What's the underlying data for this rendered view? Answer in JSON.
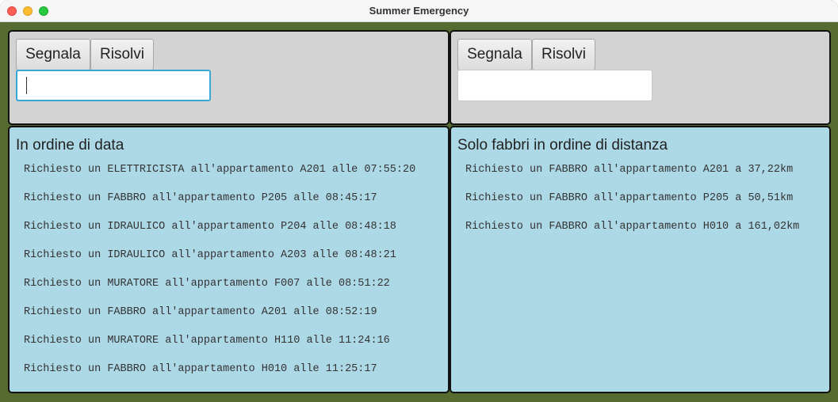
{
  "window": {
    "title": "Summer Emergency"
  },
  "left": {
    "segnala_label": "Segnala",
    "risolvi_label": "Risolvi",
    "input_value": "",
    "heading": "In ordine di data",
    "requests": [
      "Richiesto un ELETTRICISTA all'appartamento A201 alle 07:55:20",
      "Richiesto un FABBRO all'appartamento P205 alle 08:45:17",
      "Richiesto un IDRAULICO all'appartamento P204 alle 08:48:18",
      "Richiesto un IDRAULICO all'appartamento A203 alle 08:48:21",
      "Richiesto un MURATORE all'appartamento F007 alle 08:51:22",
      "Richiesto un FABBRO all'appartamento A201 alle 08:52:19",
      "Richiesto un MURATORE all'appartamento H110 alle 11:24:16",
      "Richiesto un FABBRO all'appartamento H010 alle 11:25:17"
    ]
  },
  "right": {
    "segnala_label": "Segnala",
    "risolvi_label": "Risolvi",
    "input_value": "",
    "heading": "Solo fabbri in ordine di distanza",
    "requests": [
      "Richiesto un FABBRO all'appartamento A201 a 37,22km",
      "Richiesto un FABBRO all'appartamento P205 a 50,51km",
      "Richiesto un FABBRO all'appartamento H010 a 161,02km"
    ]
  },
  "colors": {
    "window_background": "#556b2f",
    "control_panel": "#d3d3d3",
    "list_panel": "#add8e6",
    "focus_ring": "#38a8d8"
  }
}
